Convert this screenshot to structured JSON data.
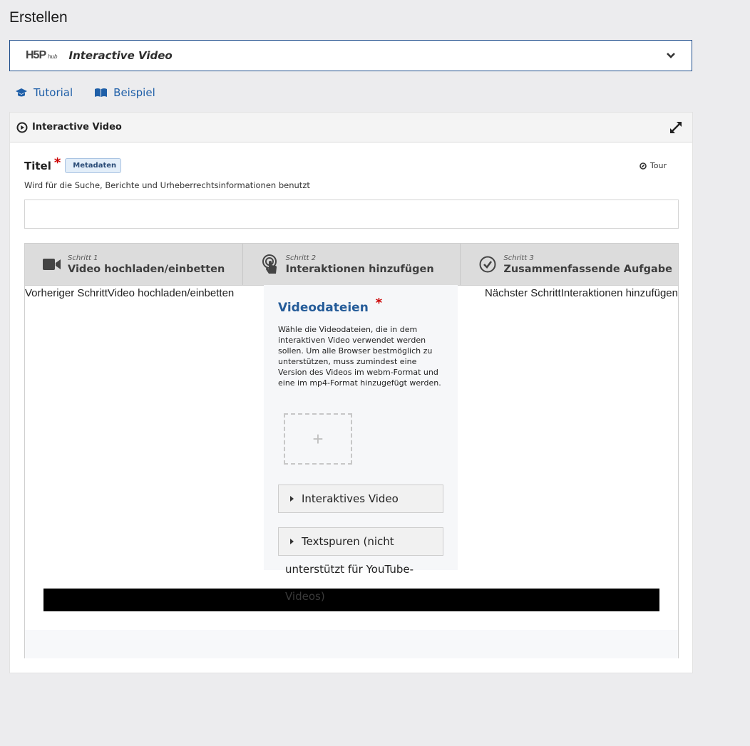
{
  "page_title": "Erstellen",
  "hub": {
    "logo_main": "H5P",
    "logo_sub": "hub",
    "selected": "Interactive Video"
  },
  "links": {
    "tutorial": "Tutorial",
    "example": "Beispiel"
  },
  "panel": {
    "title": "Interactive Video",
    "field_title_label": "Titel",
    "required_mark": "*",
    "metadata_button": "Metadaten",
    "tour_label": "Tour",
    "field_title_desc": "Wird für die Suche, Berichte und Urheberrechtsinformationen benutzt",
    "title_value": ""
  },
  "wizard": {
    "steps": [
      {
        "num": "Schritt 1",
        "label": "Video hochladen/einbetten",
        "icon": "video-camera-icon"
      },
      {
        "num": "Schritt 2",
        "label": "Interaktionen hinzufügen",
        "icon": "touch-icon"
      },
      {
        "num": "Schritt 3",
        "label": "Zusammenfassende Aufgabe",
        "icon": "check-circle-icon"
      }
    ],
    "prev": "Vorheriger SchrittVideo hochladen/einbetten",
    "next": "Nächster SchrittInteraktionen hinzufügen"
  },
  "video": {
    "label": "Videodateien",
    "description": "Wähle die Videodateien, die in dem interaktiven Video verwendet werden sollen. Um alle Browser bestmöglich zu unterstützen, muss zumindest eine Version des Videos im webm-Format und eine im mp4-Format hinzugefügt werden.",
    "upload_symbol": "+",
    "groups": [
      {
        "label": "Interaktives Video"
      },
      {
        "label": "Textspuren (nicht"
      }
    ],
    "overflow_line1": "unterstützt für YouTube-",
    "overflow_line2": "Videos)"
  }
}
